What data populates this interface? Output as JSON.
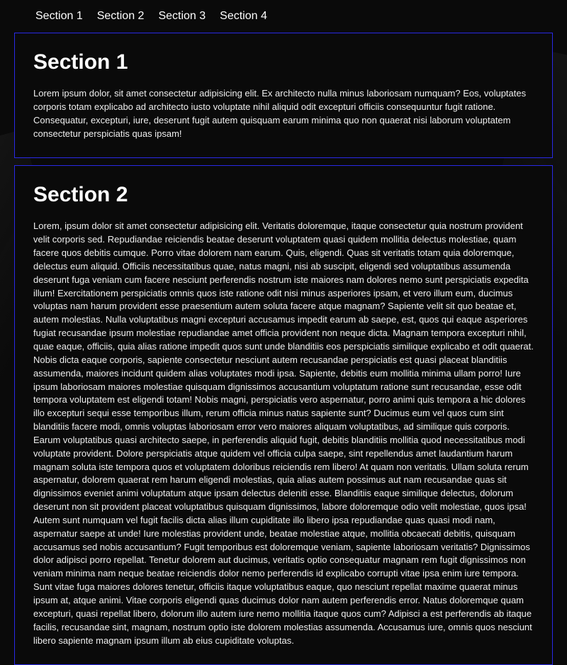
{
  "nav": {
    "items": [
      {
        "label": "Section 1"
      },
      {
        "label": "Section 2"
      },
      {
        "label": "Section 3"
      },
      {
        "label": "Section 4"
      }
    ]
  },
  "sections": [
    {
      "title": "Section 1",
      "body": "Lorem ipsum dolor, sit amet consectetur adipisicing elit. Ex architecto nulla minus laboriosam numquam? Eos, voluptates corporis totam explicabo ad architecto iusto voluptate nihil aliquid odit excepturi officiis consequuntur fugit ratione. Consequatur, excepturi, iure, deserunt fugit autem quisquam earum minima quo non quaerat nisi laborum voluptatem consectetur perspiciatis quas ipsam!"
    },
    {
      "title": "Section 2",
      "body": "Lorem, ipsum dolor sit amet consectetur adipisicing elit. Veritatis doloremque, itaque consectetur quia nostrum provident velit corporis sed. Repudiandae reiciendis beatae deserunt voluptatem quasi quidem mollitia delectus molestiae, quam facere quos debitis cumque. Porro vitae dolorem nam earum. Quis, eligendi. Quas sit veritatis totam quia doloremque, delectus eum aliquid. Officiis necessitatibus quae, natus magni, nisi ab suscipit, eligendi sed voluptatibus assumenda deserunt fuga veniam cum facere nesciunt perferendis nostrum iste maiores nam dolores nemo sunt perspiciatis expedita illum! Exercitationem perspiciatis omnis quos iste ratione odit nisi minus asperiores ipsam, et vero illum eum, ducimus voluptas nam harum provident esse praesentium autem soluta facere atque magnam? Sapiente velit sit quo beatae et, autem molestias. Nulla voluptatibus magni excepturi accusamus impedit earum ab saepe, est, quos qui eaque asperiores fugiat recusandae ipsum molestiae repudiandae amet officia provident non neque dicta. Magnam tempora excepturi nihil, quae eaque, officiis, quia alias ratione impedit quos sunt unde blanditiis eos perspiciatis similique explicabo et odit quaerat. Nobis dicta eaque corporis, sapiente consectetur nesciunt autem recusandae perspiciatis est quasi placeat blanditiis assumenda, maiores incidunt quidem alias voluptates modi ipsa. Sapiente, debitis eum mollitia minima ullam porro! Iure ipsum laboriosam maiores molestiae quisquam dignissimos accusantium voluptatum ratione sunt recusandae, esse odit tempora voluptatem est eligendi totam! Nobis magni, perspiciatis vero aspernatur, porro animi quis tempora a hic dolores illo excepturi sequi esse temporibus illum, rerum officia minus natus sapiente sunt? Ducimus eum vel quos cum sint blanditiis facere modi, omnis voluptas laboriosam error vero maiores aliquam voluptatibus, ad similique quis corporis. Earum voluptatibus quasi architecto saepe, in perferendis aliquid fugit, debitis blanditiis mollitia quod necessitatibus modi voluptate provident. Dolore perspiciatis atque quidem vel officia culpa saepe, sint repellendus amet laudantium harum magnam soluta iste tempora quos et voluptatem doloribus reiciendis rem libero! At quam non veritatis. Ullam soluta rerum aspernatur, dolorem quaerat rem harum eligendi molestias, quia alias autem possimus aut nam recusandae quas sit dignissimos eveniet animi voluptatum atque ipsam delectus deleniti esse. Blanditiis eaque similique delectus, dolorum deserunt non sit provident placeat voluptatibus quisquam dignissimos, labore doloremque odio velit molestiae, quos ipsa! Autem sunt numquam vel fugit facilis dicta alias illum cupiditate illo libero ipsa repudiandae quas quasi modi nam, aspernatur saepe at unde! Iure molestias provident unde, beatae molestiae atque, mollitia obcaecati debitis, quisquam accusamus sed nobis accusantium? Fugit temporibus est doloremque veniam, sapiente laboriosam veritatis? Dignissimos dolor adipisci porro repellat. Tenetur dolorem aut ducimus, veritatis optio consequatur magnam rem fugit dignissimos non veniam minima nam neque beatae reiciendis dolor nemo perferendis id explicabo corrupti vitae ipsa enim iure tempora. Sunt vitae fuga maiores dolores tenetur, officiis itaque voluptatibus eaque, quo nesciunt repellat maxime quaerat minus ipsum at, atque animi. Vitae corporis eligendi quas ducimus dolor nam autem perferendis error. Natus doloremque quam excepturi, quasi repellat libero, dolorum illo autem iure nemo mollitia itaque quos cum? Adipisci a est perferendis ab itaque facilis, recusandae sint, magnam, nostrum optio iste dolorem molestias assumenda. Accusamus iure, omnis quos nesciunt libero sapiente magnam ipsum illum ab eius cupiditate voluptas."
    }
  ]
}
